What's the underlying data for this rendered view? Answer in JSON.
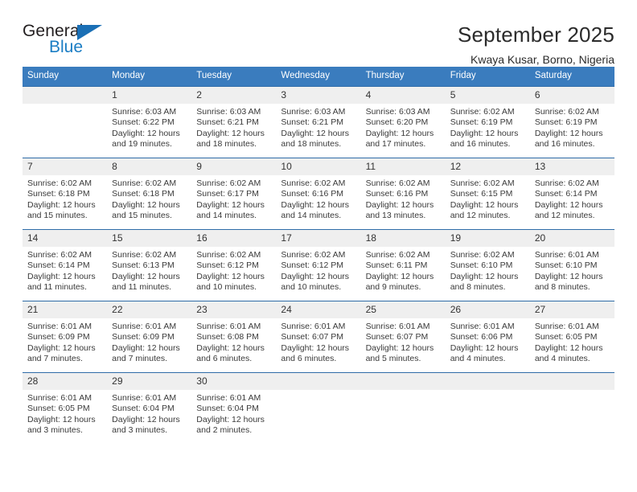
{
  "logo": {
    "word_top": "General",
    "word_bottom": "Blue",
    "triangle_color": "#1a6fb5",
    "blue_color": "#1a7dc4"
  },
  "header": {
    "title": "September 2025",
    "subtitle": "Kwaya Kusar, Borno, Nigeria"
  },
  "theme": {
    "header_blue": "#3a7cbe",
    "row_border_blue": "#2f6ca8",
    "daynum_band": "#efefef"
  },
  "calendar": {
    "weekday_headers": [
      "Sunday",
      "Monday",
      "Tuesday",
      "Wednesday",
      "Thursday",
      "Friday",
      "Saturday"
    ],
    "weeks": [
      [
        {
          "day": "",
          "empty": true
        },
        {
          "day": "1",
          "sunrise": "Sunrise: 6:03 AM",
          "sunset": "Sunset: 6:22 PM",
          "daylight1": "Daylight: 12 hours",
          "daylight2": "and 19 minutes."
        },
        {
          "day": "2",
          "sunrise": "Sunrise: 6:03 AM",
          "sunset": "Sunset: 6:21 PM",
          "daylight1": "Daylight: 12 hours",
          "daylight2": "and 18 minutes."
        },
        {
          "day": "3",
          "sunrise": "Sunrise: 6:03 AM",
          "sunset": "Sunset: 6:21 PM",
          "daylight1": "Daylight: 12 hours",
          "daylight2": "and 18 minutes."
        },
        {
          "day": "4",
          "sunrise": "Sunrise: 6:03 AM",
          "sunset": "Sunset: 6:20 PM",
          "daylight1": "Daylight: 12 hours",
          "daylight2": "and 17 minutes."
        },
        {
          "day": "5",
          "sunrise": "Sunrise: 6:02 AM",
          "sunset": "Sunset: 6:19 PM",
          "daylight1": "Daylight: 12 hours",
          "daylight2": "and 16 minutes."
        },
        {
          "day": "6",
          "sunrise": "Sunrise: 6:02 AM",
          "sunset": "Sunset: 6:19 PM",
          "daylight1": "Daylight: 12 hours",
          "daylight2": "and 16 minutes."
        }
      ],
      [
        {
          "day": "7",
          "sunrise": "Sunrise: 6:02 AM",
          "sunset": "Sunset: 6:18 PM",
          "daylight1": "Daylight: 12 hours",
          "daylight2": "and 15 minutes."
        },
        {
          "day": "8",
          "sunrise": "Sunrise: 6:02 AM",
          "sunset": "Sunset: 6:18 PM",
          "daylight1": "Daylight: 12 hours",
          "daylight2": "and 15 minutes."
        },
        {
          "day": "9",
          "sunrise": "Sunrise: 6:02 AM",
          "sunset": "Sunset: 6:17 PM",
          "daylight1": "Daylight: 12 hours",
          "daylight2": "and 14 minutes."
        },
        {
          "day": "10",
          "sunrise": "Sunrise: 6:02 AM",
          "sunset": "Sunset: 6:16 PM",
          "daylight1": "Daylight: 12 hours",
          "daylight2": "and 14 minutes."
        },
        {
          "day": "11",
          "sunrise": "Sunrise: 6:02 AM",
          "sunset": "Sunset: 6:16 PM",
          "daylight1": "Daylight: 12 hours",
          "daylight2": "and 13 minutes."
        },
        {
          "day": "12",
          "sunrise": "Sunrise: 6:02 AM",
          "sunset": "Sunset: 6:15 PM",
          "daylight1": "Daylight: 12 hours",
          "daylight2": "and 12 minutes."
        },
        {
          "day": "13",
          "sunrise": "Sunrise: 6:02 AM",
          "sunset": "Sunset: 6:14 PM",
          "daylight1": "Daylight: 12 hours",
          "daylight2": "and 12 minutes."
        }
      ],
      [
        {
          "day": "14",
          "sunrise": "Sunrise: 6:02 AM",
          "sunset": "Sunset: 6:14 PM",
          "daylight1": "Daylight: 12 hours",
          "daylight2": "and 11 minutes."
        },
        {
          "day": "15",
          "sunrise": "Sunrise: 6:02 AM",
          "sunset": "Sunset: 6:13 PM",
          "daylight1": "Daylight: 12 hours",
          "daylight2": "and 11 minutes."
        },
        {
          "day": "16",
          "sunrise": "Sunrise: 6:02 AM",
          "sunset": "Sunset: 6:12 PM",
          "daylight1": "Daylight: 12 hours",
          "daylight2": "and 10 minutes."
        },
        {
          "day": "17",
          "sunrise": "Sunrise: 6:02 AM",
          "sunset": "Sunset: 6:12 PM",
          "daylight1": "Daylight: 12 hours",
          "daylight2": "and 10 minutes."
        },
        {
          "day": "18",
          "sunrise": "Sunrise: 6:02 AM",
          "sunset": "Sunset: 6:11 PM",
          "daylight1": "Daylight: 12 hours",
          "daylight2": "and 9 minutes."
        },
        {
          "day": "19",
          "sunrise": "Sunrise: 6:02 AM",
          "sunset": "Sunset: 6:10 PM",
          "daylight1": "Daylight: 12 hours",
          "daylight2": "and 8 minutes."
        },
        {
          "day": "20",
          "sunrise": "Sunrise: 6:01 AM",
          "sunset": "Sunset: 6:10 PM",
          "daylight1": "Daylight: 12 hours",
          "daylight2": "and 8 minutes."
        }
      ],
      [
        {
          "day": "21",
          "sunrise": "Sunrise: 6:01 AM",
          "sunset": "Sunset: 6:09 PM",
          "daylight1": "Daylight: 12 hours",
          "daylight2": "and 7 minutes."
        },
        {
          "day": "22",
          "sunrise": "Sunrise: 6:01 AM",
          "sunset": "Sunset: 6:09 PM",
          "daylight1": "Daylight: 12 hours",
          "daylight2": "and 7 minutes."
        },
        {
          "day": "23",
          "sunrise": "Sunrise: 6:01 AM",
          "sunset": "Sunset: 6:08 PM",
          "daylight1": "Daylight: 12 hours",
          "daylight2": "and 6 minutes."
        },
        {
          "day": "24",
          "sunrise": "Sunrise: 6:01 AM",
          "sunset": "Sunset: 6:07 PM",
          "daylight1": "Daylight: 12 hours",
          "daylight2": "and 6 minutes."
        },
        {
          "day": "25",
          "sunrise": "Sunrise: 6:01 AM",
          "sunset": "Sunset: 6:07 PM",
          "daylight1": "Daylight: 12 hours",
          "daylight2": "and 5 minutes."
        },
        {
          "day": "26",
          "sunrise": "Sunrise: 6:01 AM",
          "sunset": "Sunset: 6:06 PM",
          "daylight1": "Daylight: 12 hours",
          "daylight2": "and 4 minutes."
        },
        {
          "day": "27",
          "sunrise": "Sunrise: 6:01 AM",
          "sunset": "Sunset: 6:05 PM",
          "daylight1": "Daylight: 12 hours",
          "daylight2": "and 4 minutes."
        }
      ],
      [
        {
          "day": "28",
          "sunrise": "Sunrise: 6:01 AM",
          "sunset": "Sunset: 6:05 PM",
          "daylight1": "Daylight: 12 hours",
          "daylight2": "and 3 minutes."
        },
        {
          "day": "29",
          "sunrise": "Sunrise: 6:01 AM",
          "sunset": "Sunset: 6:04 PM",
          "daylight1": "Daylight: 12 hours",
          "daylight2": "and 3 minutes."
        },
        {
          "day": "30",
          "sunrise": "Sunrise: 6:01 AM",
          "sunset": "Sunset: 6:04 PM",
          "daylight1": "Daylight: 12 hours",
          "daylight2": "and 2 minutes."
        },
        {
          "day": "",
          "empty": true
        },
        {
          "day": "",
          "empty": true
        },
        {
          "day": "",
          "empty": true
        },
        {
          "day": "",
          "empty": true
        }
      ]
    ]
  }
}
